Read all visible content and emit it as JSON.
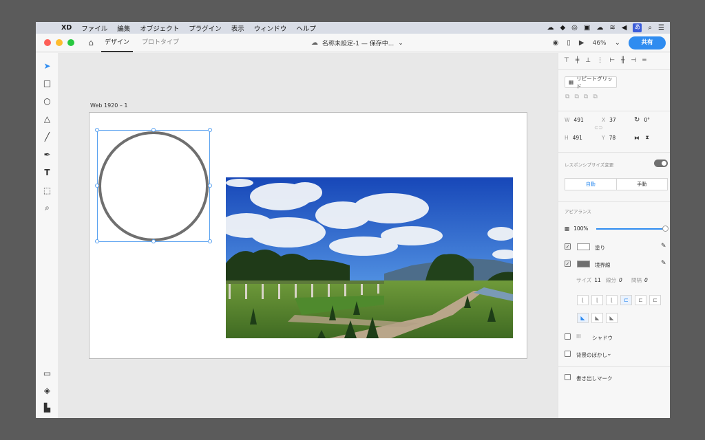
{
  "menubar": {
    "items": [
      "XD",
      "ファイル",
      "編集",
      "オブジェクト",
      "プラグイン",
      "表示",
      "ウィンドウ",
      "ヘルプ"
    ],
    "ime_label": "あ"
  },
  "titlebar": {
    "tabs": [
      "デザイン",
      "プロトタイプ"
    ],
    "doc_title": "名称未設定-1 — 保存中...",
    "zoom": "46%",
    "share_label": "共有"
  },
  "canvas": {
    "artboard_label": "Web 1920 – 1"
  },
  "panel": {
    "repeat_grid_label": "リピートグリッド",
    "w_label": "W",
    "w_value": "491",
    "h_label": "H",
    "h_value": "491",
    "x_label": "X",
    "x_value": "37",
    "y_label": "Y",
    "y_value": "78",
    "rotation": "0°",
    "responsive_label": "レスポンシブサイズ変更",
    "responsive_on": true,
    "auto_label": "自動",
    "manual_label": "手動",
    "appearance_label": "アピアランス",
    "opacity": "100%",
    "opacity_fraction": 1.0,
    "fill_label": "塗り",
    "fill_color": "#ffffff",
    "stroke_label": "境界線",
    "stroke_color": "#6f6f6f",
    "size_label": "サイズ",
    "size_value": "11",
    "dash_label": "線分",
    "dash_value": "0",
    "gap_label": "間隔",
    "gap_value": "0",
    "shadow_label": "シャドウ",
    "bg_blur_label": "背景のぼかし",
    "export_label": "書き出しマーク"
  },
  "colors": {
    "accent": "#2f8cf0",
    "selection": "#5aa2f0"
  }
}
